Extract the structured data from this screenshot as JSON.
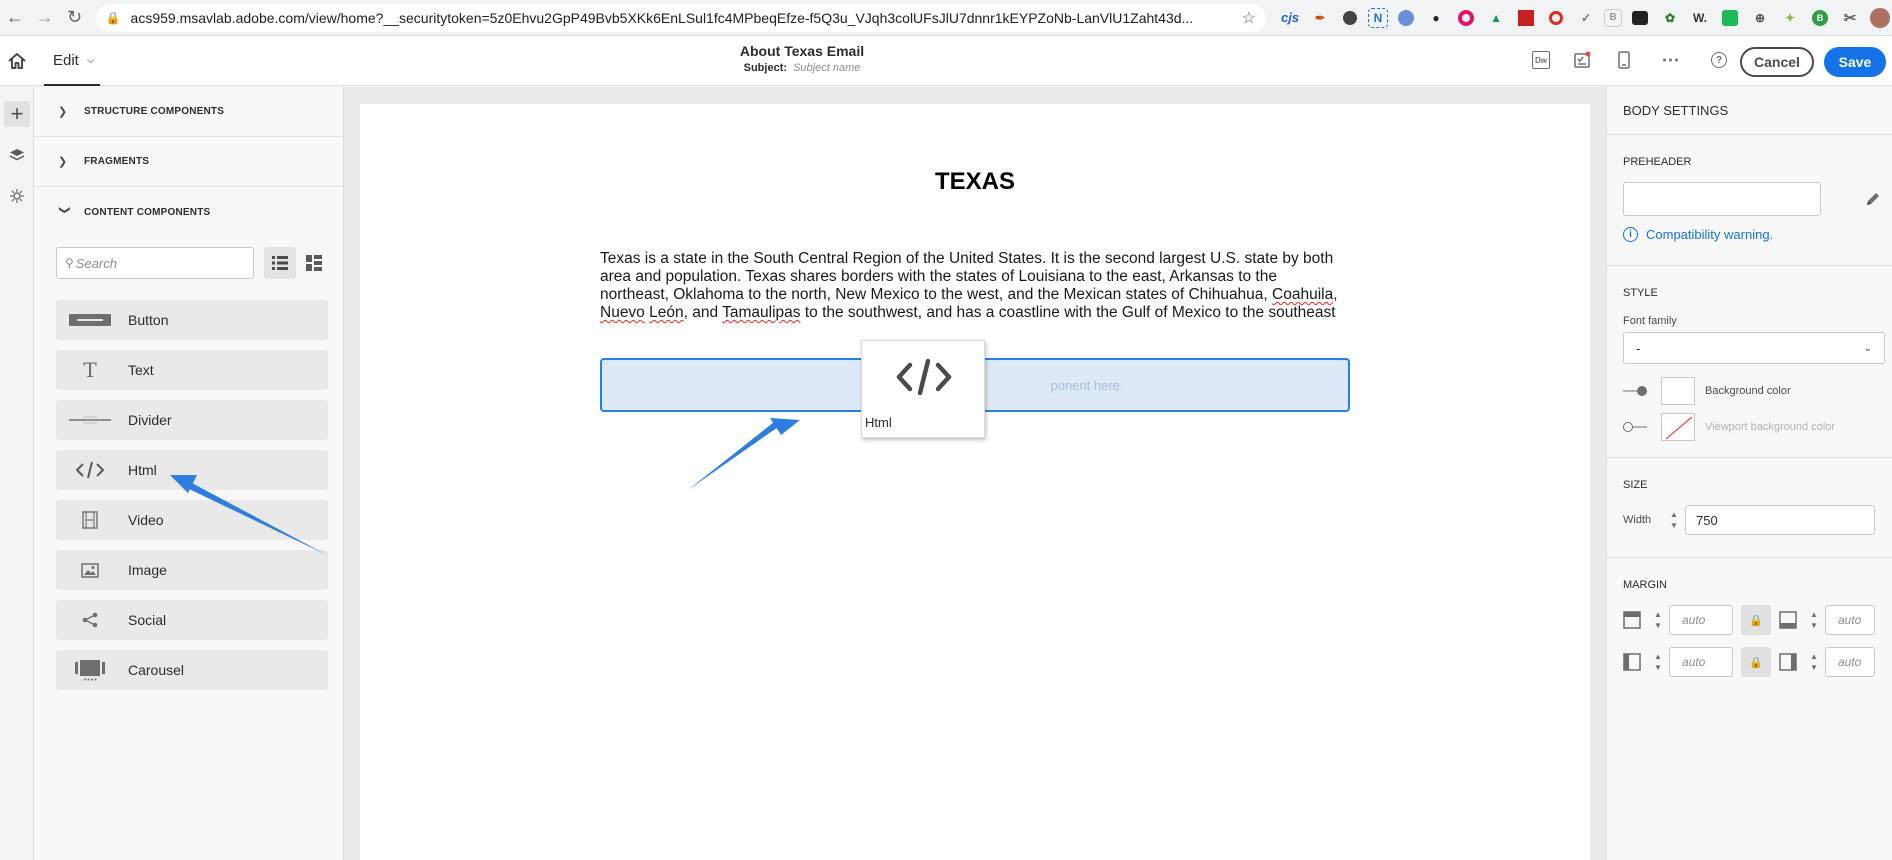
{
  "browser": {
    "url": "acs959.msavlab.adobe.com/view/home?__securitytoken=5z0Ehvu2GpP49Bvb5XKk6EnLSul1fc4MPbeqEfze-f5Q3u_VJqh3colUFsJlU7dnnr1kEYPZoNb-LanVlU1Zaht43d...",
    "extensions": [
      "cjs",
      "N",
      "W."
    ]
  },
  "header": {
    "edit_label": "Edit",
    "title": "About Texas Email",
    "subject_label": "Subject:",
    "subject_placeholder": "Subject name",
    "cancel_label": "Cancel",
    "save_label": "Save",
    "accent_color": "#1473e6"
  },
  "components_panel": {
    "sections": [
      {
        "label": "STRUCTURE COMPONENTS",
        "expanded": false
      },
      {
        "label": "FRAGMENTS",
        "expanded": false
      },
      {
        "label": "CONTENT COMPONENTS",
        "expanded": true
      }
    ],
    "search_placeholder": "Search",
    "items": [
      {
        "label": "Button",
        "icon": "button-icon"
      },
      {
        "label": "Text",
        "icon": "text-icon"
      },
      {
        "label": "Divider",
        "icon": "divider-icon"
      },
      {
        "label": "Html",
        "icon": "code-icon"
      },
      {
        "label": "Video",
        "icon": "film-icon"
      },
      {
        "label": "Image",
        "icon": "image-icon"
      },
      {
        "label": "Social",
        "icon": "share-icon"
      },
      {
        "label": "Carousel",
        "icon": "carousel-icon"
      }
    ]
  },
  "canvas": {
    "heading": "TEXAS",
    "body_parts": [
      "Texas is a state in the South Central Region of the United States. It is the second largest U.S. state by both area and population. Texas shares borders with the states of Louisiana to the east, Arkansas to the northeast, Oklahoma to the north, New Mexico to the west, and the Mexican states of Chihuahua, ",
      "Coahuila",
      ", ",
      "Nuevo",
      " ",
      "León",
      ", and ",
      "Tamaulipas",
      " to the southwest, and has a coastline with the Gulf of Mexico to the southeast"
    ],
    "drop_zone_text": "ponent here.",
    "drag_ghost_label": "Html"
  },
  "settings": {
    "title": "BODY SETTINGS",
    "preheader_label": "PREHEADER",
    "compat_warning": "Compatibility warning.",
    "style_label": "STYLE",
    "font_family_label": "Font family",
    "font_family_value": "-",
    "background_color_label": "Background color",
    "viewport_bg_label": "Viewport background color",
    "size_label": "SIZE",
    "width_label": "Width",
    "width_value": "750",
    "margin_label": "MARGIN",
    "margin_placeholder": "auto"
  }
}
